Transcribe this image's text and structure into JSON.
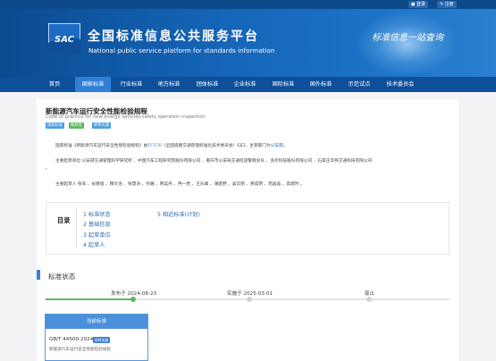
{
  "topbar": {
    "login": "登录",
    "register": "注册"
  },
  "header": {
    "logo_text": "SAC",
    "title_cn": "全国标准信息公共服务平台",
    "title_en": "National public service platform  for standards information",
    "slogan": "标准信息一站查询"
  },
  "nav": {
    "items": [
      "首页",
      "国家标准",
      "行业标准",
      "地方标准",
      "团体标准",
      "企业标准",
      "国际标准",
      "国外标准",
      "示范试点",
      "技术委员会"
    ],
    "active": 1
  },
  "document": {
    "title": "新能源汽车运行安全性能检验规程",
    "title_en": "Code of practice for new energy vehicles safety operation inspection",
    "tags": [
      {
        "label": "国家标准",
        "color": "#4a9fe0"
      },
      {
        "label": "推荐性",
        "color": "#5cb85c"
      },
      {
        "label": "即将实施",
        "color": "#4a9fe0"
      }
    ]
  },
  "paragraphs": {
    "p1_a": "国家标准《新能源汽车运行安全性能检验规程》由",
    "p1_tc": "TC576",
    "p1_b": "（全国道路交通管理标准化技术委员会）归口，主管部门为",
    "p1_dept": "公安部",
    "p1_c": "。",
    "p2_a": "主要起草单位 公安部交通管理科学研究所 、中国汽车工程研究院股份有限公司 、重庆市公安局交通巡逻警察总队 、多伦科技股份有限公司 、石家庄华燕交通科技有限公司",
    "p2_b": "。",
    "p3": "主要起草人 张军 、俞春俊 、穆文浩 、张慧涛 、孙巍 、韩奕丹 、冉一岩 、王乐峰 、蒲建野 、吴云丽 、庾成明 、周晶晶 、高建时 。"
  },
  "toc": {
    "label": "目录",
    "items": [
      "1 标准状态",
      "2 基础信息",
      "3 起草单位",
      "4 起草人",
      "5 相近标准(计划)"
    ]
  },
  "status": {
    "section_title": "标准状态",
    "timeline": {
      "published": "发布于 2024-08-23",
      "implemented": "实施于 2025-03-01",
      "abolished": "废止"
    },
    "progress": 0.22
  },
  "current_standard": {
    "header": "当前标准",
    "code": "GB/T 44500-2024",
    "badge": "即将实施",
    "name": "新能源汽车运行安全性能检验规程"
  },
  "colors": {
    "nav_bg": "#0d4f9a",
    "nav_active": "#2f7fd6",
    "link": "#2b6cb3",
    "progress": "#5cb85c",
    "accent": "#3a7ed8"
  }
}
